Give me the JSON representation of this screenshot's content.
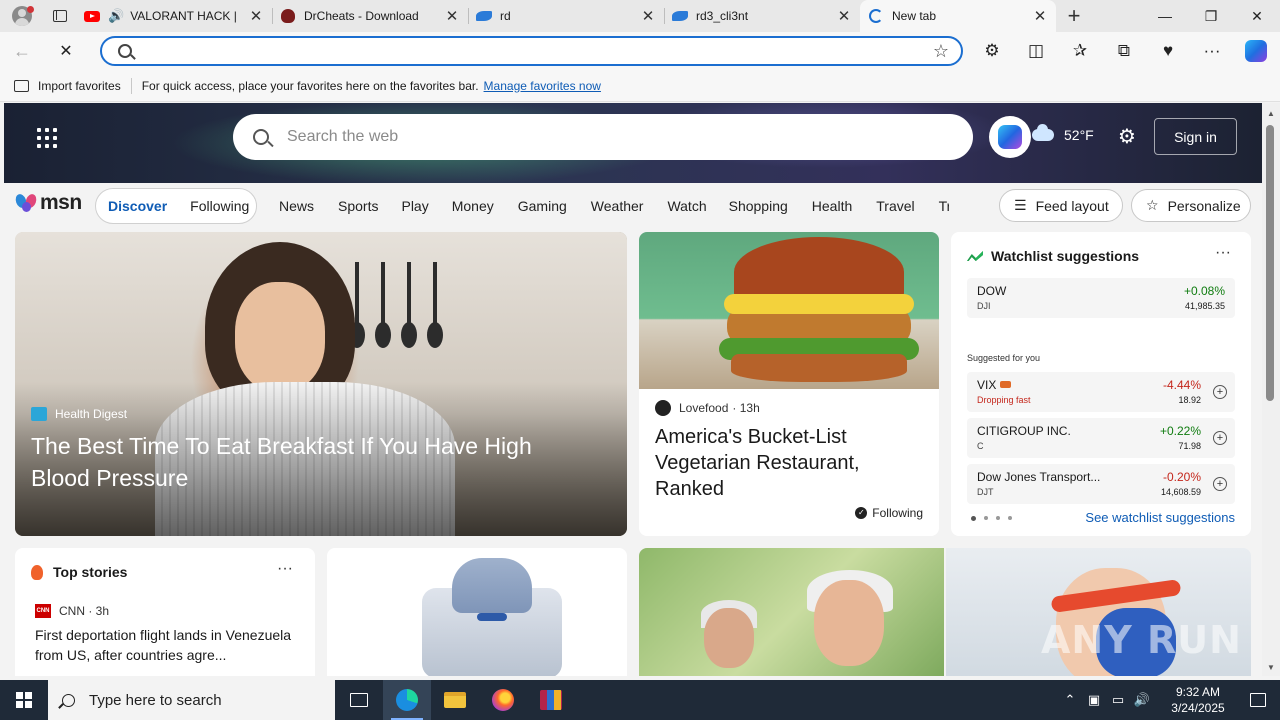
{
  "browser": {
    "tabs": [
      {
        "title": "VALORANT HACK | ",
        "favicon": "youtube-icon",
        "audio": true,
        "active": false
      },
      {
        "title": "DrCheats - Download",
        "favicon": "drcheats-icon",
        "active": false
      },
      {
        "title": "rd",
        "favicon": "rd-icon",
        "active": false
      },
      {
        "title": "rd3_cli3nt",
        "favicon": "rd-icon",
        "active": false
      },
      {
        "title": "New tab",
        "favicon": "edge-loading-icon",
        "active": true
      }
    ],
    "address": {
      "value": "",
      "placeholder": ""
    },
    "favorites_bar": {
      "import_label": "Import favorites",
      "message": "For quick access, place your favorites here on the favorites bar.",
      "link": "Manage favorites now"
    }
  },
  "msn": {
    "search_placeholder": "Search the web",
    "weather": {
      "temp": "52°F",
      "icon": "cloud-icon"
    },
    "signin_label": "Sign in",
    "logo_text": "msn",
    "feed_tabs": {
      "active": "Discover",
      "inactive": "Following"
    },
    "categories": [
      "News",
      "Sports",
      "Play",
      "Money",
      "Gaming",
      "Weather",
      "Watch",
      "Shopping",
      "Health",
      "Travel",
      "Tra"
    ],
    "feed_layout_label": "Feed layout",
    "personalize_label": "Personalize",
    "hero": {
      "source": "Health Digest",
      "headline": "The Best Time To Eat Breakfast If You Have High Blood Pressure"
    },
    "card2": {
      "source": "Lovefood",
      "age": "· 13h",
      "headline": "America's Bucket-List Vegetarian Restaurant, Ranked",
      "following_label": "Following"
    },
    "watchlist": {
      "title": "Watchlist suggestions",
      "top": {
        "symbol": "DOW",
        "sub": "DJI",
        "change": "+0.08%",
        "value": "41,985.35",
        "direction": "up"
      },
      "suggested_label": "Suggested for you",
      "suggested": [
        {
          "symbol": "VIX",
          "sub": "Dropping fast",
          "change": "-4.44%",
          "value": "18.92",
          "direction": "down",
          "badge": true
        },
        {
          "symbol": "CITIGROUP INC.",
          "sub": "C",
          "change": "+0.22%",
          "value": "71.98",
          "direction": "up"
        },
        {
          "symbol": "Dow Jones Transport...",
          "sub": "DJT",
          "change": "-0.20%",
          "value": "14,608.59",
          "direction": "down"
        }
      ],
      "see_more": "See watchlist suggestions",
      "colors": {
        "up": "#107c10",
        "down": "#c4271c"
      }
    },
    "top_stories": {
      "title": "Top stories",
      "source": "CNN · 3h",
      "headline": "First deportation flight lands in Venezuela from US, after countries agre..."
    },
    "watermark": "ANY RUN"
  },
  "taskbar": {
    "search_placeholder": "Type here to search",
    "time": "9:32 AM",
    "date": "3/24/2025"
  }
}
